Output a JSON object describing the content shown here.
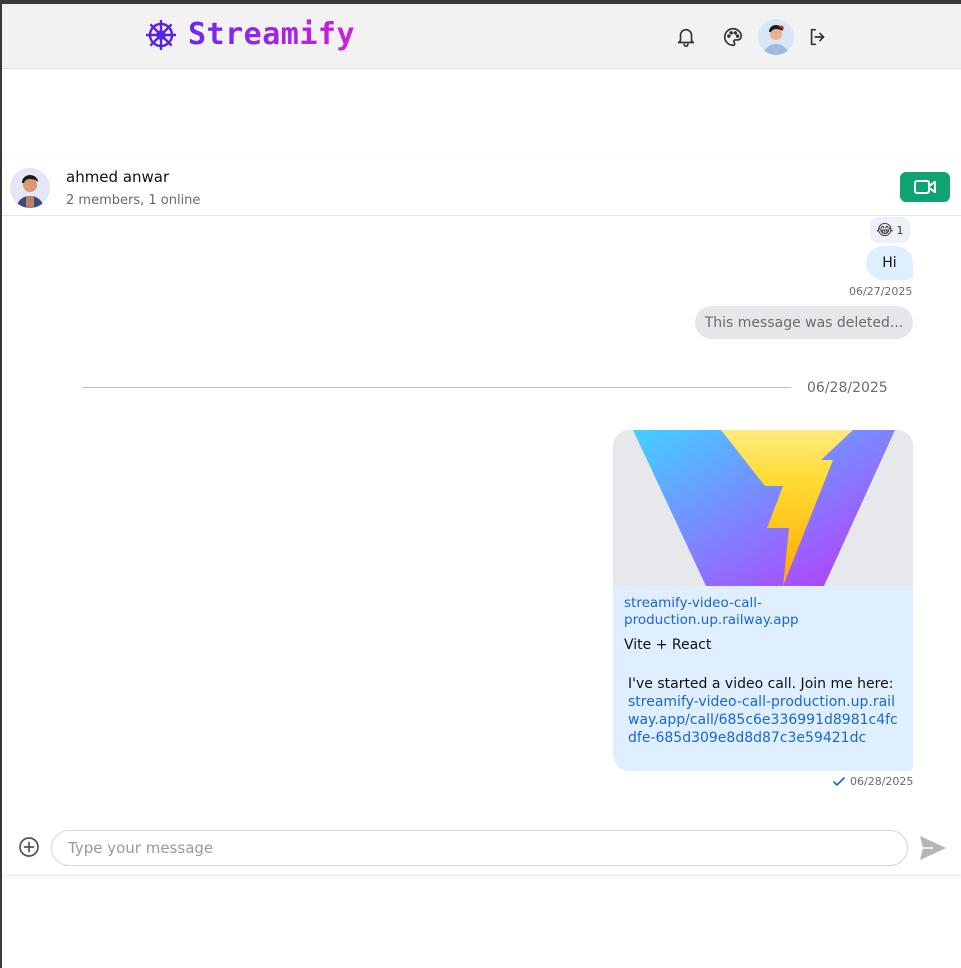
{
  "app": {
    "brand": "Streamify",
    "brand_colors": [
      "#6d28f2",
      "#d11fd9"
    ]
  },
  "navbar": {
    "icons": [
      "ship-wheel-icon",
      "bell-icon",
      "palette-icon",
      "user-avatar",
      "logout-icon"
    ]
  },
  "channel": {
    "name": "ahmed anwar",
    "meta": "2 members, 1 online",
    "video_call_icon": "video-camera-icon",
    "accent_color": "#0ea371"
  },
  "messages": {
    "reaction": {
      "emoji": "😂",
      "count": "1"
    },
    "hi": {
      "text": "Hi",
      "timestamp": "06/27/2025"
    },
    "deleted": {
      "text": "This message was deleted..."
    },
    "date_separator": "06/28/2025",
    "link_card": {
      "link_text": "streamify-video-call-production.up.railway.app",
      "title": "Vite + React",
      "text": "I've started a video call. Join me here:",
      "url": "streamify-video-call-production.up.railway.app/call/685c6e336991d8981c4fcdfe-685d309e8d8d87c3e59421dc",
      "timestamp": "06/28/2025",
      "status_icon": "check-icon"
    }
  },
  "composer": {
    "placeholder": "Type your message",
    "value": "",
    "attach_icon": "plus-circle-icon",
    "send_icon": "send-icon"
  }
}
